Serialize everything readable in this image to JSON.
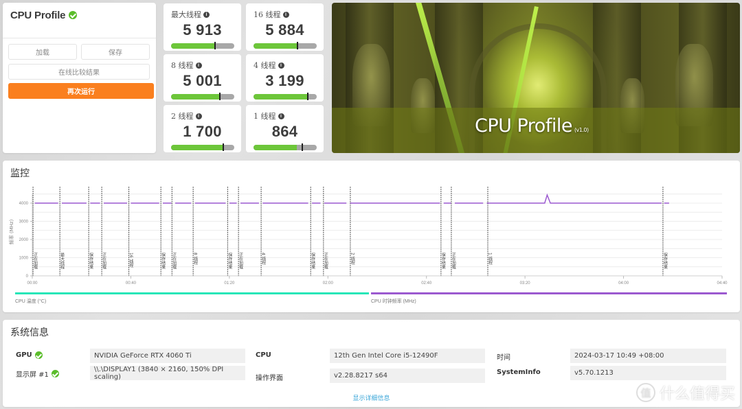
{
  "app": {
    "title": "CPU Profile",
    "status_icon": "check-circle-icon"
  },
  "controls": {
    "load_label": "加载",
    "save_label": "保存",
    "compare_label": "在线比较结果",
    "run_again_label": "再次运行",
    "run_again_color": "#fa7f1e"
  },
  "scores": [
    {
      "label": "最大线程",
      "value": "5 913",
      "bar_fill_pct": 68,
      "marker_pct": 69
    },
    {
      "label": "16 线程",
      "value": "5 884",
      "bar_fill_pct": 69,
      "marker_pct": 69
    },
    {
      "label": "8 线程",
      "value": "5 001",
      "bar_fill_pct": 76,
      "marker_pct": 76
    },
    {
      "label": "4 线程",
      "value": "3 199",
      "bar_fill_pct": 85,
      "marker_pct": 85
    },
    {
      "label": "2 线程",
      "value": "1 700",
      "bar_fill_pct": 82,
      "marker_pct": 82
    },
    {
      "label": "1 线程",
      "value": "864",
      "bar_fill_pct": 69,
      "marker_pct": 76
    }
  ],
  "hero": {
    "title": "CPU Profile",
    "version": "(v1.0)"
  },
  "monitor": {
    "title": "监控",
    "chart_data": {
      "type": "line",
      "title": "",
      "xlabel": "",
      "ylabel": "频率 (MHz)",
      "xlim": [
        0,
        280
      ],
      "ylim": [
        0,
        4500
      ],
      "grid": true,
      "x_ticks": [
        {
          "t": 0,
          "label": "00:00"
        },
        {
          "t": 40,
          "label": "00:40"
        },
        {
          "t": 80,
          "label": "01:20"
        },
        {
          "t": 120,
          "label": "02:00"
        },
        {
          "t": 160,
          "label": "02:40"
        },
        {
          "t": 200,
          "label": "03:20"
        },
        {
          "t": 240,
          "label": "04:00"
        },
        {
          "t": 280,
          "label": "04:40"
        }
      ],
      "y_ticks": [
        0,
        1000,
        2000,
        3000,
        4000
      ],
      "series": [
        {
          "name": "CPU 时钟频率 (MHz)",
          "color": "#9b59d0",
          "segments": [
            [
              [
                1,
                4000
              ],
              [
                10.5,
                4000
              ]
            ],
            [
              [
                12,
                4000
              ],
              [
                22,
                4000
              ]
            ],
            [
              [
                23.5,
                4000
              ],
              [
                27.5,
                4000
              ]
            ],
            [
              [
                29,
                4000
              ],
              [
                38.5,
                4000
              ]
            ],
            [
              [
                40,
                4000
              ],
              [
                51.5,
                4000
              ]
            ],
            [
              [
                53,
                4000
              ],
              [
                56.5,
                4000
              ]
            ],
            [
              [
                58,
                4000
              ],
              [
                64.5,
                4000
              ]
            ],
            [
              [
                66,
                4000
              ],
              [
                78.5,
                4000
              ]
            ],
            [
              [
                80,
                4000
              ],
              [
                83,
                4000
              ]
            ],
            [
              [
                84.5,
                4000
              ],
              [
                92,
                4000
              ]
            ],
            [
              [
                93.5,
                4000
              ],
              [
                112,
                4000
              ]
            ],
            [
              [
                113.5,
                4000
              ],
              [
                117,
                4000
              ]
            ],
            [
              [
                118.5,
                4000
              ],
              [
                127.5,
                4000
              ]
            ],
            [
              [
                129,
                4000
              ],
              [
                165.5,
                4000
              ]
            ],
            [
              [
                167,
                4000
              ],
              [
                170,
                4000
              ]
            ],
            [
              [
                171.5,
                4000
              ],
              [
                183,
                4000
              ]
            ],
            [
              [
                184.5,
                4000
              ],
              [
                208,
                4000
              ],
              [
                209,
                4450
              ],
              [
                210.3,
                4000
              ],
              [
                255.5,
                4000
              ]
            ],
            [
              [
                256.5,
                4000
              ],
              [
                258.5,
                4000
              ]
            ]
          ]
        },
        {
          "name": "CPU 温度 (°C)",
          "color": "#27e6b8",
          "segments": []
        }
      ],
      "markers": [
        {
          "t": 0.3,
          "label": "正在加载"
        },
        {
          "t": 11.2,
          "label": "最大线程"
        },
        {
          "t": 22.9,
          "label": "保存结果"
        },
        {
          "t": 28.2,
          "label": "正在加载"
        },
        {
          "t": 39.2,
          "label": "16 线程"
        },
        {
          "t": 52.2,
          "label": "保存结果"
        },
        {
          "t": 56.7,
          "label": "正在加载"
        },
        {
          "t": 65.3,
          "label": "8 线程"
        },
        {
          "t": 79.3,
          "label": "保存结果"
        },
        {
          "t": 83.7,
          "label": "正在加载"
        },
        {
          "t": 92.9,
          "label": "4 线程"
        },
        {
          "t": 113,
          "label": "保存结果"
        },
        {
          "t": 118.2,
          "label": "正在加载"
        },
        {
          "t": 129.1,
          "label": "2 线程"
        },
        {
          "t": 165.9,
          "label": "保存结果"
        },
        {
          "t": 170.1,
          "label": "正在加载"
        },
        {
          "t": 184.9,
          "label": "1 线程"
        },
        {
          "t": 256,
          "label": "保存结果"
        }
      ],
      "legend": [
        {
          "name": "CPU 温度 (°C)",
          "color": "#27e6b8"
        },
        {
          "name": "CPU 时钟频率 (MHz)",
          "color": "#9b59d0"
        }
      ],
      "legend_placement": "bottom"
    }
  },
  "system_info": {
    "title": "系统信息",
    "rows": [
      {
        "label": "GPU",
        "value": "NVIDIA GeForce RTX 4060 Ti",
        "verified": true
      },
      {
        "label": "显示屏 #1",
        "value": "\\\\.\\DISPLAY1 (3840 × 2160, 150% DPI scaling)",
        "verified": true
      },
      {
        "label": "CPU",
        "value": "12th Gen Intel Core i5-12490F"
      },
      {
        "label": "操作界面",
        "value": "v2.28.8217 s64"
      },
      {
        "label": "时间",
        "value": "2024-03-17 10:49 +08:00"
      },
      {
        "label": "SystemInfo",
        "value": "v5.70.1213"
      }
    ],
    "details_link": "显示详细信息"
  },
  "watermark": {
    "circle_char": "值",
    "text": "什么值得买"
  }
}
